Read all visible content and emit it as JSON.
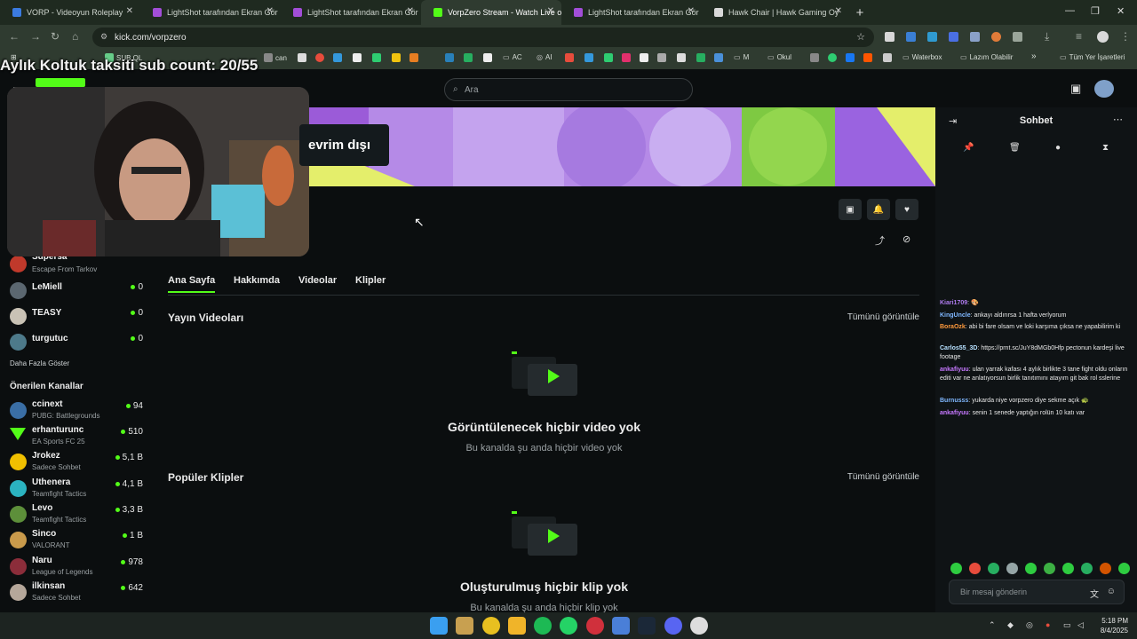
{
  "browser": {
    "tabs": [
      {
        "title": "VORP - Videoyun Roleplay",
        "favicon_color": "#3b7be0"
      },
      {
        "title": "LightShot tarafından Ekran Gör",
        "favicon_color": "#a24ed8"
      },
      {
        "title": "LightShot tarafından Ekran Gör",
        "favicon_color": "#a24ed8"
      },
      {
        "title": "VorpZero Stream - Watch Live o",
        "favicon_color": "#53fc18"
      },
      {
        "title": "LightShot tarafından Ekran Gör",
        "favicon_color": "#a24ed8"
      },
      {
        "title": "Hawk Chair | Hawk Gaming Oy",
        "favicon_color": "#d9d9d9"
      }
    ],
    "new_tab": "+",
    "url": "kick.com/vorpzero",
    "bookmarks": [
      "SUB QL",
      "can",
      "AC",
      "AI",
      "M",
      "Okul",
      "Waterbox",
      "Lazım Olabilir",
      "»",
      "Tüm Yer İşaretleri"
    ]
  },
  "overlay": {
    "text": "Aylık Koltuk taksiti sub count: 20/55"
  },
  "header": {
    "search_placeholder": "Ara"
  },
  "channel": {
    "offline_label": "evrim dışı"
  },
  "sidebar": {
    "following": [
      {
        "name": "Supersa",
        "game": "Escape From Tarkov",
        "count": "",
        "avatar_color": "#c0392b"
      },
      {
        "name": "LeMiell",
        "game": "",
        "count": "0",
        "avatar_color": "#5b6770"
      },
      {
        "name": "TEASY",
        "game": "",
        "count": "0",
        "avatar_color": "#c9c2b5"
      },
      {
        "name": "turgutuc",
        "game": "",
        "count": "0",
        "avatar_color": "#4d7a8a"
      }
    ],
    "show_more": "Daha Fazla Göster",
    "recommended_heading": "Önerilen Kanallar",
    "recommended": [
      {
        "name": "ccinext",
        "game": "PUBG: Battlegrounds",
        "count": "94",
        "avatar_color": "#3a6ea5"
      },
      {
        "name": "erhanturunc",
        "game": "EA Sports FC 25",
        "count": "510",
        "avatar_color": "#53fc18"
      },
      {
        "name": "Jrokez",
        "game": "Sadece Sohbet",
        "count": "5,1 B",
        "avatar_color": "#f0c000"
      },
      {
        "name": "Uthenera",
        "game": "Teamfight Tactics",
        "count": "4,1 B",
        "avatar_color": "#2bb3c0"
      },
      {
        "name": "Levo",
        "game": "Teamfight Tactics",
        "count": "3,3 B",
        "avatar_color": "#5d8f3a"
      },
      {
        "name": "Sinco",
        "game": "VALORANT",
        "count": "1 B",
        "avatar_color": "#c99a4b"
      },
      {
        "name": "Naru",
        "game": "League of Legends",
        "count": "978",
        "avatar_color": "#8b2d3a"
      },
      {
        "name": "ilkinsan",
        "game": "Sadece Sohbet",
        "count": "642",
        "avatar_color": "#b5a79a"
      }
    ]
  },
  "content_tabs": [
    "Ana Sayfa",
    "Hakkımda",
    "Videolar",
    "Klipler"
  ],
  "sections": {
    "videos": {
      "title": "Yayın Videoları",
      "see_all": "Tümünü görüntüle",
      "empty_title": "Görüntülenecek hiçbir video yok",
      "empty_sub": "Bu kanalda şu anda hiçbir video yok"
    },
    "clips": {
      "title": "Popüler Klipler",
      "see_all": "Tümünü görüntüle",
      "empty_title": "Oluşturulmuş hiçbir klip yok",
      "empty_sub": "Bu kanalda şu anda hiçbir klip yok"
    }
  },
  "chat": {
    "title": "Sohbet",
    "messages": [
      {
        "user": "Kiari1709",
        "user_color": "#b07cf0",
        "text": "🎨"
      },
      {
        "user": "KingUncle",
        "user_color": "#7fb7ff",
        "text": "ankayı aldırırsa 1 hafta verlyorum"
      },
      {
        "user": "BoraOzk",
        "user_color": "#ff9a3c",
        "text": "abi bi fare olsam ve loki karşıma çıksa ne yapabilirim ki"
      },
      {
        "user": "Carlos55_3D",
        "user_color": "#b6e0ff",
        "text": "https://prnt.sc/JuY8dMGb0Hfp pectonun kardeşi live footage"
      },
      {
        "user": "ankafiyuu",
        "user_color": "#c678ff",
        "text": "ulan yarrak kafası 4 aylık birlikte 3 tane fight oldu onların editi var ne anlatıyorsun birlik tanıtımını atayım git bak rol sslerine"
      },
      {
        "user": "Burnusss",
        "user_color": "#7fb7ff",
        "text": "yukarda niye vorpzero diye sekme açık 🐢"
      },
      {
        "user": "ankafiyuu",
        "user_color": "#c678ff",
        "text": "senin 1 senede yaptığın rolün 10 katı var"
      }
    ],
    "input_placeholder": "Bir mesaj gönderin"
  },
  "taskbar": {
    "time": "5:18 PM",
    "date": "8/4/2025"
  }
}
